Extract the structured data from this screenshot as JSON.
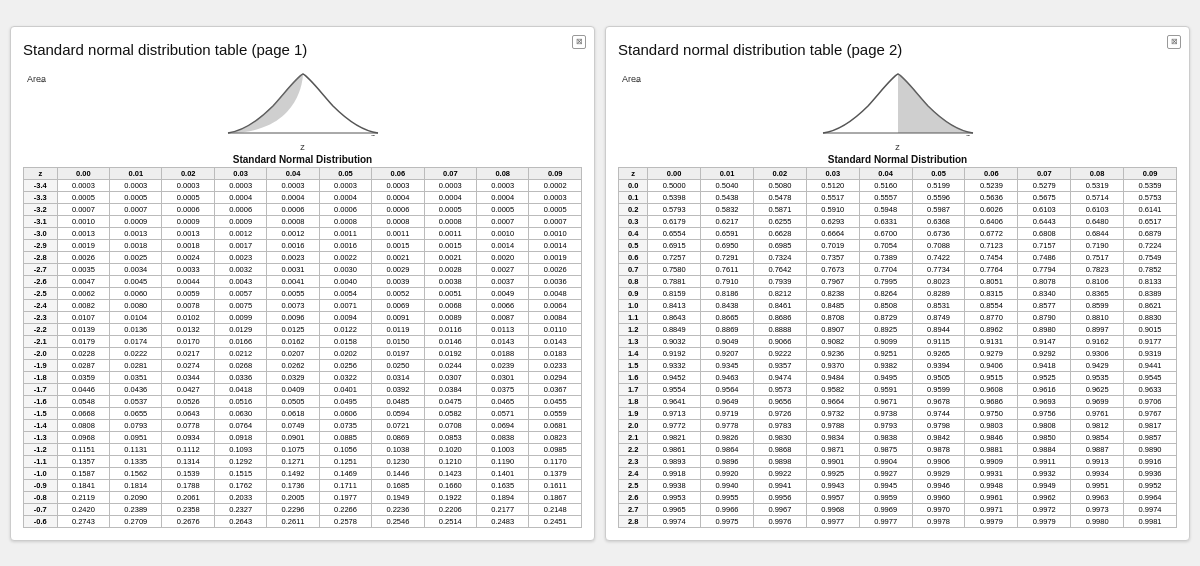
{
  "page1": {
    "title": "Standard normal distribution table (page 1)",
    "table_title": "Standard Normal Distribution",
    "columns": [
      "z",
      "0.00",
      "0.01",
      "0.02",
      "0.03",
      "0.04",
      "0.05",
      "0.06",
      "0.07",
      "0.08",
      "0.09"
    ],
    "rows": [
      [
        "-3.4",
        "0.0003",
        "0.0003",
        "0.0003",
        "0.0003",
        "0.0003",
        "0.0003",
        "0.0003",
        "0.0003",
        "0.0003",
        "0.0002"
      ],
      [
        "-3.3",
        "0.0005",
        "0.0005",
        "0.0005",
        "0.0004",
        "0.0004",
        "0.0004",
        "0.0004",
        "0.0004",
        "0.0004",
        "0.0003"
      ],
      [
        "-3.2",
        "0.0007",
        "0.0007",
        "0.0006",
        "0.0006",
        "0.0006",
        "0.0006",
        "0.0006",
        "0.0005",
        "0.0005",
        "0.0005"
      ],
      [
        "-3.1",
        "0.0010",
        "0.0009",
        "0.0009",
        "0.0009",
        "0.0008",
        "0.0008",
        "0.0008",
        "0.0008",
        "0.0007",
        "0.0007"
      ],
      [
        "-3.0",
        "0.0013",
        "0.0013",
        "0.0013",
        "0.0012",
        "0.0012",
        "0.0011",
        "0.0011",
        "0.0011",
        "0.0010",
        "0.0010"
      ],
      [
        "-2.9",
        "0.0019",
        "0.0018",
        "0.0018",
        "0.0017",
        "0.0016",
        "0.0016",
        "0.0015",
        "0.0015",
        "0.0014",
        "0.0014"
      ],
      [
        "-2.8",
        "0.0026",
        "0.0025",
        "0.0024",
        "0.0023",
        "0.0023",
        "0.0022",
        "0.0021",
        "0.0021",
        "0.0020",
        "0.0019"
      ],
      [
        "-2.7",
        "0.0035",
        "0.0034",
        "0.0033",
        "0.0032",
        "0.0031",
        "0.0030",
        "0.0029",
        "0.0028",
        "0.0027",
        "0.0026"
      ],
      [
        "-2.6",
        "0.0047",
        "0.0045",
        "0.0044",
        "0.0043",
        "0.0041",
        "0.0040",
        "0.0039",
        "0.0038",
        "0.0037",
        "0.0036"
      ],
      [
        "-2.5",
        "0.0062",
        "0.0060",
        "0.0059",
        "0.0057",
        "0.0055",
        "0.0054",
        "0.0052",
        "0.0051",
        "0.0049",
        "0.0048"
      ],
      [
        "-2.4",
        "0.0082",
        "0.0080",
        "0.0078",
        "0.0075",
        "0.0073",
        "0.0071",
        "0.0069",
        "0.0068",
        "0.0066",
        "0.0064"
      ],
      [
        "-2.3",
        "0.0107",
        "0.0104",
        "0.0102",
        "0.0099",
        "0.0096",
        "0.0094",
        "0.0091",
        "0.0089",
        "0.0087",
        "0.0084"
      ],
      [
        "-2.2",
        "0.0139",
        "0.0136",
        "0.0132",
        "0.0129",
        "0.0125",
        "0.0122",
        "0.0119",
        "0.0116",
        "0.0113",
        "0.0110"
      ],
      [
        "-2.1",
        "0.0179",
        "0.0174",
        "0.0170",
        "0.0166",
        "0.0162",
        "0.0158",
        "0.0150",
        "0.0146",
        "0.0143",
        "0.0143"
      ],
      [
        "-2.0",
        "0.0228",
        "0.0222",
        "0.0217",
        "0.0212",
        "0.0207",
        "0.0202",
        "0.0197",
        "0.0192",
        "0.0188",
        "0.0183"
      ],
      [
        "-1.9",
        "0.0287",
        "0.0281",
        "0.0274",
        "0.0268",
        "0.0262",
        "0.0256",
        "0.0250",
        "0.0244",
        "0.0239",
        "0.0233"
      ],
      [
        "-1.8",
        "0.0359",
        "0.0351",
        "0.0344",
        "0.0336",
        "0.0329",
        "0.0322",
        "0.0314",
        "0.0307",
        "0.0301",
        "0.0294"
      ],
      [
        "-1.7",
        "0.0446",
        "0.0436",
        "0.0427",
        "0.0418",
        "0.0409",
        "0.0401",
        "0.0392",
        "0.0384",
        "0.0375",
        "0.0367"
      ],
      [
        "-1.6",
        "0.0548",
        "0.0537",
        "0.0526",
        "0.0516",
        "0.0505",
        "0.0495",
        "0.0485",
        "0.0475",
        "0.0465",
        "0.0455"
      ],
      [
        "-1.5",
        "0.0668",
        "0.0655",
        "0.0643",
        "0.0630",
        "0.0618",
        "0.0606",
        "0.0594",
        "0.0582",
        "0.0571",
        "0.0559"
      ],
      [
        "-1.4",
        "0.0808",
        "0.0793",
        "0.0778",
        "0.0764",
        "0.0749",
        "0.0735",
        "0.0721",
        "0.0708",
        "0.0694",
        "0.0681"
      ],
      [
        "-1.3",
        "0.0968",
        "0.0951",
        "0.0934",
        "0.0918",
        "0.0901",
        "0.0885",
        "0.0869",
        "0.0853",
        "0.0838",
        "0.0823"
      ],
      [
        "-1.2",
        "0.1151",
        "0.1131",
        "0.1112",
        "0.1093",
        "0.1075",
        "0.1056",
        "0.1038",
        "0.1020",
        "0.1003",
        "0.0985"
      ],
      [
        "-1.1",
        "0.1357",
        "0.1335",
        "0.1314",
        "0.1292",
        "0.1271",
        "0.1251",
        "0.1230",
        "0.1210",
        "0.1190",
        "0.1170"
      ],
      [
        "-1.0",
        "0.1587",
        "0.1562",
        "0.1539",
        "0.1515",
        "0.1492",
        "0.1469",
        "0.1446",
        "0.1423",
        "0.1401",
        "0.1379"
      ],
      [
        "-0.9",
        "0.1841",
        "0.1814",
        "0.1788",
        "0.1762",
        "0.1736",
        "0.1711",
        "0.1685",
        "0.1660",
        "0.1635",
        "0.1611"
      ],
      [
        "-0.8",
        "0.2119",
        "0.2090",
        "0.2061",
        "0.2033",
        "0.2005",
        "0.1977",
        "0.1949",
        "0.1922",
        "0.1894",
        "0.1867"
      ],
      [
        "-0.7",
        "0.2420",
        "0.2389",
        "0.2358",
        "0.2327",
        "0.2296",
        "0.2266",
        "0.2236",
        "0.2206",
        "0.2177",
        "0.2148"
      ],
      [
        "-0.6",
        "0.2743",
        "0.2709",
        "0.2676",
        "0.2643",
        "0.2611",
        "0.2578",
        "0.2546",
        "0.2514",
        "0.2483",
        "0.2451"
      ]
    ]
  },
  "page2": {
    "title": "Standard normal distribution table (page 2)",
    "table_title": "Standard Normal Distribution",
    "columns": [
      "z",
      "0.00",
      "0.01",
      "0.02",
      "0.03",
      "0.04",
      "0.05",
      "0.06",
      "0.07",
      "0.08",
      "0.09"
    ],
    "rows": [
      [
        "0.0",
        "0.5000",
        "0.5040",
        "0.5080",
        "0.5120",
        "0.5160",
        "0.5199",
        "0.5239",
        "0.5279",
        "0.5319",
        "0.5359"
      ],
      [
        "0.1",
        "0.5398",
        "0.5438",
        "0.5478",
        "0.5517",
        "0.5557",
        "0.5596",
        "0.5636",
        "0.5675",
        "0.5714",
        "0.5753"
      ],
      [
        "0.2",
        "0.5793",
        "0.5832",
        "0.5871",
        "0.5910",
        "0.5948",
        "0.5987",
        "0.6026",
        "0.6103",
        "0.6103",
        "0.6141"
      ],
      [
        "0.3",
        "0.6179",
        "0.6217",
        "0.6255",
        "0.6293",
        "0.6331",
        "0.6368",
        "0.6406",
        "0.6443",
        "0.6480",
        "0.6517"
      ],
      [
        "0.4",
        "0.6554",
        "0.6591",
        "0.6628",
        "0.6664",
        "0.6700",
        "0.6736",
        "0.6772",
        "0.6808",
        "0.6844",
        "0.6879"
      ],
      [
        "0.5",
        "0.6915",
        "0.6950",
        "0.6985",
        "0.7019",
        "0.7054",
        "0.7088",
        "0.7123",
        "0.7157",
        "0.7190",
        "0.7224"
      ],
      [
        "0.6",
        "0.7257",
        "0.7291",
        "0.7324",
        "0.7357",
        "0.7389",
        "0.7422",
        "0.7454",
        "0.7486",
        "0.7517",
        "0.7549"
      ],
      [
        "0.7",
        "0.7580",
        "0.7611",
        "0.7642",
        "0.7673",
        "0.7704",
        "0.7734",
        "0.7764",
        "0.7794",
        "0.7823",
        "0.7852"
      ],
      [
        "0.8",
        "0.7881",
        "0.7910",
        "0.7939",
        "0.7967",
        "0.7995",
        "0.8023",
        "0.8051",
        "0.8078",
        "0.8106",
        "0.8133"
      ],
      [
        "0.9",
        "0.8159",
        "0.8186",
        "0.8212",
        "0.8238",
        "0.8264",
        "0.8289",
        "0.8315",
        "0.8340",
        "0.8365",
        "0.8389"
      ],
      [
        "1.0",
        "0.8413",
        "0.8438",
        "0.8461",
        "0.8485",
        "0.8508",
        "0.8531",
        "0.8554",
        "0.8577",
        "0.8599",
        "0.8621"
      ],
      [
        "1.1",
        "0.8643",
        "0.8665",
        "0.8686",
        "0.8708",
        "0.8729",
        "0.8749",
        "0.8770",
        "0.8790",
        "0.8810",
        "0.8830"
      ],
      [
        "1.2",
        "0.8849",
        "0.8869",
        "0.8888",
        "0.8907",
        "0.8925",
        "0.8944",
        "0.8962",
        "0.8980",
        "0.8997",
        "0.9015"
      ],
      [
        "1.3",
        "0.9032",
        "0.9049",
        "0.9066",
        "0.9082",
        "0.9099",
        "0.9115",
        "0.9131",
        "0.9147",
        "0.9162",
        "0.9177"
      ],
      [
        "1.4",
        "0.9192",
        "0.9207",
        "0.9222",
        "0.9236",
        "0.9251",
        "0.9265",
        "0.9279",
        "0.9292",
        "0.9306",
        "0.9319"
      ],
      [
        "1.5",
        "0.9332",
        "0.9345",
        "0.9357",
        "0.9370",
        "0.9382",
        "0.9394",
        "0.9406",
        "0.9418",
        "0.9429",
        "0.9441"
      ],
      [
        "1.6",
        "0.9452",
        "0.9463",
        "0.9474",
        "0.9484",
        "0.9495",
        "0.9505",
        "0.9515",
        "0.9525",
        "0.9535",
        "0.9545"
      ],
      [
        "1.7",
        "0.9554",
        "0.9564",
        "0.9573",
        "0.9582",
        "0.9591",
        "0.9599",
        "0.9608",
        "0.9616",
        "0.9625",
        "0.9633"
      ],
      [
        "1.8",
        "0.9641",
        "0.9649",
        "0.9656",
        "0.9664",
        "0.9671",
        "0.9678",
        "0.9686",
        "0.9693",
        "0.9699",
        "0.9706"
      ],
      [
        "1.9",
        "0.9713",
        "0.9719",
        "0.9726",
        "0.9732",
        "0.9738",
        "0.9744",
        "0.9750",
        "0.9756",
        "0.9761",
        "0.9767"
      ],
      [
        "2.0",
        "0.9772",
        "0.9778",
        "0.9783",
        "0.9788",
        "0.9793",
        "0.9798",
        "0.9803",
        "0.9808",
        "0.9812",
        "0.9817"
      ],
      [
        "2.1",
        "0.9821",
        "0.9826",
        "0.9830",
        "0.9834",
        "0.9838",
        "0.9842",
        "0.9846",
        "0.9850",
        "0.9854",
        "0.9857"
      ],
      [
        "2.2",
        "0.9861",
        "0.9864",
        "0.9868",
        "0.9871",
        "0.9875",
        "0.9878",
        "0.9881",
        "0.9884",
        "0.9887",
        "0.9890"
      ],
      [
        "2.3",
        "0.9893",
        "0.9896",
        "0.9898",
        "0.9901",
        "0.9904",
        "0.9906",
        "0.9909",
        "0.9911",
        "0.9913",
        "0.9916"
      ],
      [
        "2.4",
        "0.9918",
        "0.9920",
        "0.9922",
        "0.9925",
        "0.9927",
        "0.9929",
        "0.9931",
        "0.9932",
        "0.9934",
        "0.9936"
      ],
      [
        "2.5",
        "0.9938",
        "0.9940",
        "0.9941",
        "0.9943",
        "0.9945",
        "0.9946",
        "0.9948",
        "0.9949",
        "0.9951",
        "0.9952"
      ],
      [
        "2.6",
        "0.9953",
        "0.9955",
        "0.9956",
        "0.9957",
        "0.9959",
        "0.9960",
        "0.9961",
        "0.9962",
        "0.9963",
        "0.9964"
      ],
      [
        "2.7",
        "0.9965",
        "0.9966",
        "0.9967",
        "0.9968",
        "0.9969",
        "0.9970",
        "0.9971",
        "0.9972",
        "0.9973",
        "0.9974"
      ],
      [
        "2.8",
        "0.9974",
        "0.9975",
        "0.9976",
        "0.9977",
        "0.9977",
        "0.9978",
        "0.9979",
        "0.9979",
        "0.9980",
        "0.9981"
      ]
    ]
  }
}
